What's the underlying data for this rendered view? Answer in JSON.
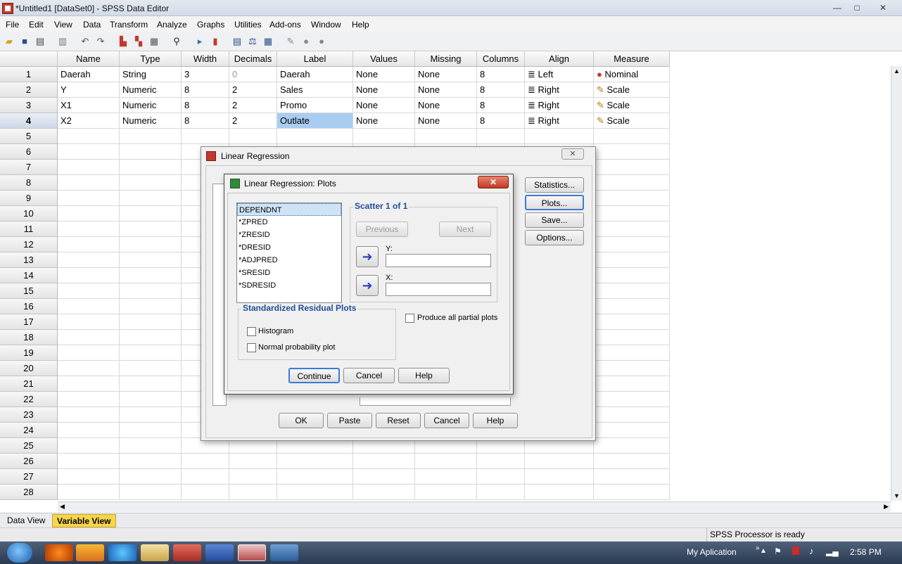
{
  "window": {
    "title": "*Untitled1 [DataSet0] - SPSS Data Editor",
    "min": "—",
    "max": "□",
    "close": "✕"
  },
  "menu": [
    "File",
    "Edit",
    "View",
    "Data",
    "Transform",
    "Analyze",
    "Graphs",
    "Utilities",
    "Add-ons",
    "Window",
    "Help"
  ],
  "toolbar_icons": [
    "open-icon",
    "save-icon",
    "print-icon",
    "recall-dialog-icon",
    "undo-icon",
    "redo-icon",
    "goto-case-icon",
    "goto-variable-icon",
    "variables-icon",
    "find-icon",
    "insert-cases-icon",
    "insert-variable-icon",
    "split-file-icon",
    "weight-cases-icon",
    "select-cases-icon",
    "value-labels-icon",
    "use-sets-icon",
    "show-all-icon"
  ],
  "columns": [
    "Name",
    "Type",
    "Width",
    "Decimals",
    "Label",
    "Values",
    "Missing",
    "Columns",
    "Align",
    "Measure"
  ],
  "rows": [
    {
      "num": "1",
      "name": "Daerah",
      "type": "String",
      "width": "3",
      "decimals": "0",
      "label": "Daerah",
      "values": "None",
      "missing": "None",
      "columns": "8",
      "align": "Left",
      "measure": "Nominal"
    },
    {
      "num": "2",
      "name": "Y",
      "type": "Numeric",
      "width": "8",
      "decimals": "2",
      "label": "Sales",
      "values": "None",
      "missing": "None",
      "columns": "8",
      "align": "Right",
      "measure": "Scale"
    },
    {
      "num": "3",
      "name": "X1",
      "type": "Numeric",
      "width": "8",
      "decimals": "2",
      "label": "Promo",
      "values": "None",
      "missing": "None",
      "columns": "8",
      "align": "Right",
      "measure": "Scale"
    },
    {
      "num": "4",
      "name": "X2",
      "type": "Numeric",
      "width": "8",
      "decimals": "2",
      "label": "Outlate",
      "values": "None",
      "missing": "None",
      "columns": "8",
      "align": "Right",
      "measure": "Scale"
    }
  ],
  "row_numbers": [
    "5",
    "6",
    "7",
    "8",
    "9",
    "10",
    "11",
    "12",
    "13",
    "14",
    "15",
    "16",
    "17",
    "18",
    "19",
    "20",
    "21",
    "22",
    "23",
    "24",
    "25",
    "26",
    "27",
    "28"
  ],
  "tabs": {
    "data_view": "Data View",
    "variable_view": "Variable View"
  },
  "status": "SPSS  Processor is ready",
  "linreg": {
    "title": "Linear Regression",
    "side_buttons": [
      "Statistics...",
      "Plots...",
      "Save...",
      "Options..."
    ],
    "bottom_buttons": [
      "OK",
      "Paste",
      "Reset",
      "Cancel",
      "Help"
    ]
  },
  "plots": {
    "title": "Linear Regression: Plots",
    "variables": [
      "DEPENDNT",
      "*ZPRED",
      "*ZRESID",
      "*DRESID",
      "*ADJPRED",
      "*SRESID",
      "*SDRESID"
    ],
    "scatter_title": "Scatter 1 of 1",
    "previous": "Previous",
    "next": "Next",
    "y_label": "Y:",
    "x_label": "X:",
    "std_title": "Standardized Residual Plots",
    "histogram": "Histogram",
    "normal_prob": "Normal probability plot",
    "partial": "Produce all partial plots",
    "continue": "Continue",
    "cancel": "Cancel",
    "help": "Help"
  },
  "taskbar": {
    "tray_label": "My Aplication",
    "time": "2:58 PM"
  }
}
